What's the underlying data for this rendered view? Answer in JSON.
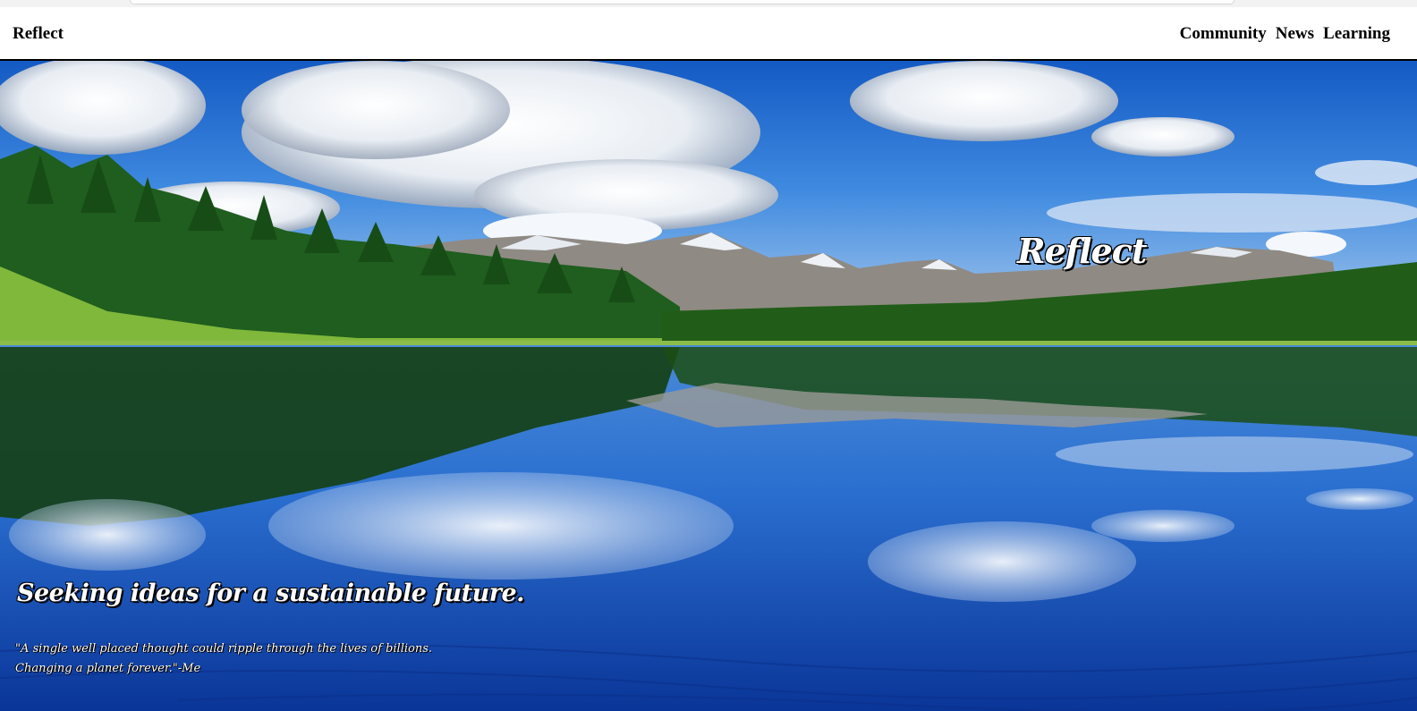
{
  "site": {
    "brand": "Reflect"
  },
  "nav": {
    "links": [
      "Community",
      "News",
      "Learning"
    ]
  },
  "hero": {
    "logo": "Reflect",
    "tagline": "Seeking ideas for a sustainable future.",
    "quote": "\"A single well placed thought could ripple through the lives of billions. Changing a planet forever.\"-Me"
  }
}
